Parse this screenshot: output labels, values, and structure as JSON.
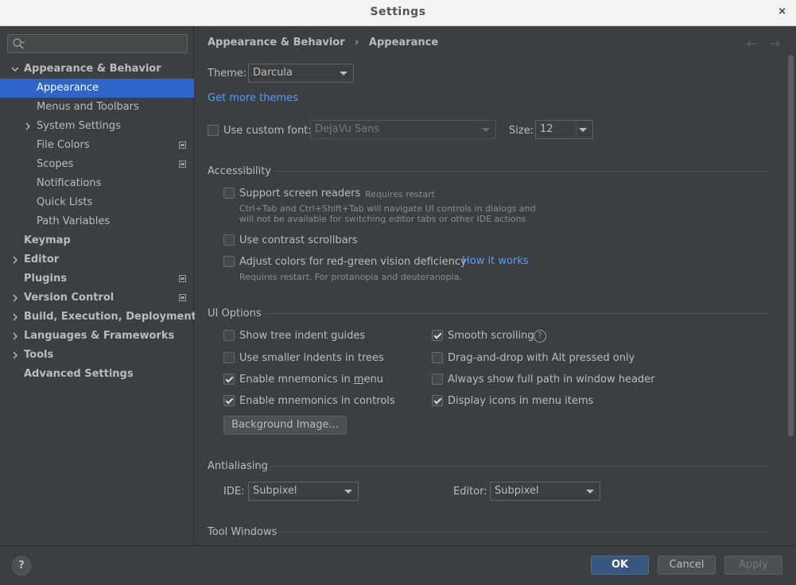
{
  "window": {
    "title": "Settings",
    "close_glyph": "×"
  },
  "search": {
    "placeholder": "",
    "icon": "search-icon"
  },
  "tree": {
    "appearance_behavior": "Appearance & Behavior",
    "appearance": "Appearance",
    "menus_toolbars": "Menus and Toolbars",
    "system_settings": "System Settings",
    "file_colors": "File Colors",
    "scopes": "Scopes",
    "notifications": "Notifications",
    "quick_lists": "Quick Lists",
    "path_variables": "Path Variables",
    "keymap": "Keymap",
    "editor": "Editor",
    "plugins": "Plugins",
    "version_control": "Version Control",
    "build": "Build, Execution, Deployment",
    "languages": "Languages & Frameworks",
    "tools": "Tools",
    "advanced": "Advanced Settings"
  },
  "breadcrumb": {
    "parent": "Appearance & Behavior",
    "separator": "›",
    "current": "Appearance"
  },
  "nav": {
    "back": "←",
    "forward": "→"
  },
  "theme": {
    "label": "Theme:",
    "value": "Darcula",
    "more_link": "Get more themes"
  },
  "font": {
    "checkbox_label": "Use custom font:",
    "checked": false,
    "value": "DejaVu Sans",
    "size_label": "Size:",
    "size_value": "12"
  },
  "accessibility": {
    "title": "Accessibility",
    "screen_readers": {
      "label": "Support screen readers",
      "note": "Requires restart",
      "help1": "Ctrl+Tab and Ctrl+Shift+Tab will navigate UI controls in dialogs and",
      "help2": "will not be available for switching editor tabs or other IDE actions",
      "checked": false
    },
    "contrast_scrollbars": {
      "label": "Use contrast scrollbars",
      "checked": false
    },
    "red_green": {
      "label": "Adjust colors for red-green vision deficiency",
      "link": "How it works",
      "help": "Requires restart. For protanopia and deuteranopia.",
      "checked": false
    }
  },
  "ui_options": {
    "title": "UI Options",
    "tree_indent": {
      "label": "Show tree indent guides",
      "checked": false
    },
    "smaller_indents": {
      "label": "Use smaller indents in trees",
      "checked": false
    },
    "mnemonics_menu": {
      "label_pre": "Enable mnemonics in ",
      "label_mn": "m",
      "label_post": "enu",
      "checked": true
    },
    "mnemonics_controls": {
      "label": "Enable mnemonics in controls",
      "checked": true
    },
    "smooth_scrolling": {
      "label": "Smooth scrolling",
      "checked": true,
      "help": "?"
    },
    "drag_drop": {
      "label": "Drag-and-drop with Alt pressed only",
      "checked": false
    },
    "full_path": {
      "label": "Always show full path in window header",
      "checked": false
    },
    "icons_menu": {
      "label": "Display icons in menu items",
      "checked": true
    },
    "background_button": "Background Image..."
  },
  "antialiasing": {
    "title": "Antialiasing",
    "ide_label": "IDE:",
    "ide_value": "Subpixel",
    "editor_label": "Editor:",
    "editor_value": "Subpixel"
  },
  "tool_windows": {
    "title": "Tool Windows"
  },
  "footer": {
    "help": "?",
    "ok": "OK",
    "cancel": "Cancel",
    "apply": "Apply"
  },
  "colors": {
    "accent": "#2f65ca",
    "link": "#589df6",
    "background": "#3c3f41",
    "primary_button": "#365880"
  }
}
